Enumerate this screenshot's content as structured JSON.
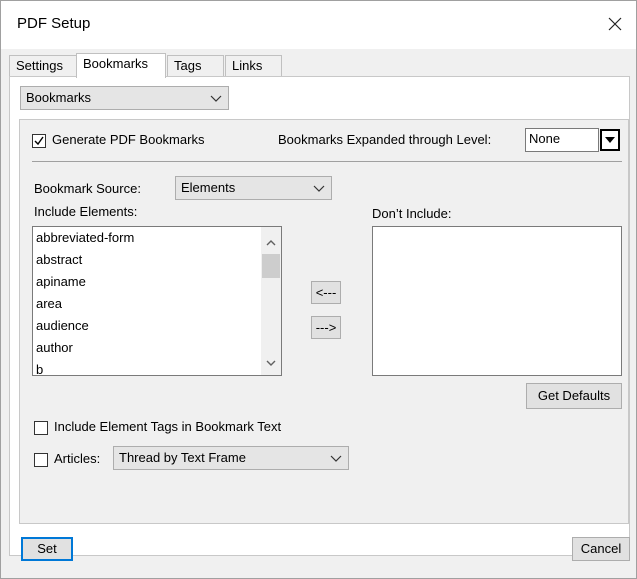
{
  "window": {
    "title": "PDF Setup"
  },
  "tabs": [
    "Settings",
    "Bookmarks",
    "Tags",
    "Links"
  ],
  "section_select": {
    "value": "Bookmarks"
  },
  "generate": {
    "label": "Generate PDF Bookmarks",
    "checked": true
  },
  "expand_level": {
    "label": "Bookmarks Expanded through Level:",
    "value": "None"
  },
  "source": {
    "label": "Bookmark Source:",
    "value": "Elements"
  },
  "include": {
    "label": "Include Elements:",
    "items": [
      "abbreviated-form",
      "abstract",
      "apiname",
      "area",
      "audience",
      "author",
      "b"
    ]
  },
  "dont_include": {
    "label": "Don’t Include:"
  },
  "move_buttons": {
    "left": "<---",
    "right": "--->"
  },
  "get_defaults": "Get Defaults",
  "include_tags": {
    "label": "Include Element Tags in Bookmark Text",
    "checked": false
  },
  "articles": {
    "label": "Articles:",
    "checked": false,
    "value": "Thread by Text Frame"
  },
  "footer": {
    "set": "Set",
    "cancel": "Cancel"
  }
}
